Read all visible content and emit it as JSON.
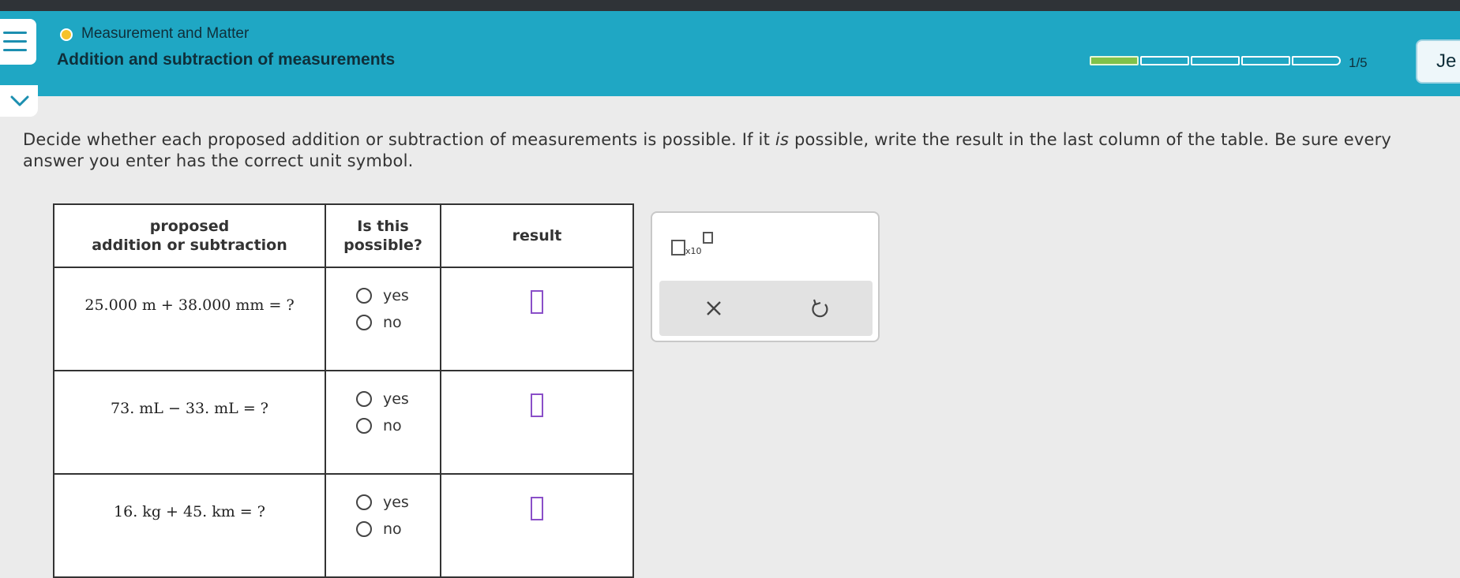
{
  "header": {
    "topic": "Measurement and Matter",
    "title": "Addition and subtraction of measurements",
    "progress_count": "1/5",
    "progress_segments": [
      true,
      false,
      false,
      false,
      false
    ],
    "user_partial": "Je"
  },
  "question": {
    "text_before": "Decide whether each proposed addition or subtraction of measurements is possible. If it ",
    "emphasis": "is",
    "text_after": " possible, write the result in the last column of the table. Be sure every answer you enter has the correct unit symbol."
  },
  "table": {
    "headers": [
      "proposed\naddition or subtraction",
      "Is this\npossible?",
      "result"
    ],
    "rows": [
      {
        "expr": "25.000 m + 38.000 mm = ?",
        "yes": "yes",
        "no": "no",
        "result": ""
      },
      {
        "expr": "73. mL − 33. mL = ?",
        "yes": "yes",
        "no": "no",
        "result": ""
      },
      {
        "expr": "16. kg + 45. km = ?",
        "yes": "yes",
        "no": "no",
        "result": ""
      }
    ]
  },
  "panel": {
    "sci_label": "x10",
    "clear_icon": "close-icon",
    "undo_icon": "undo-icon"
  },
  "colors": {
    "header": "#1fa7c4",
    "progress_done": "#7fc24a",
    "answer_box": "#8a4fc8"
  }
}
